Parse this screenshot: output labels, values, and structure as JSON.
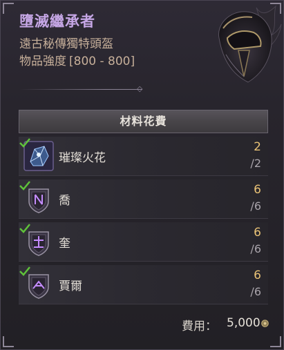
{
  "item": {
    "name": "墮滅繼承者",
    "type": "遠古秘傳獨特頭盔",
    "strength_label": "物品強度",
    "strength_value": "[800 - 800]"
  },
  "materials": {
    "header": "材料花費",
    "items": [
      {
        "name": "璀璨火花",
        "have": "2",
        "need": "/2",
        "icon": "sparkle-crystal-icon"
      },
      {
        "name": "喬",
        "have": "6",
        "need": "/6",
        "icon": "rune-shield-icon"
      },
      {
        "name": "奎",
        "have": "6",
        "need": "/6",
        "icon": "rune-shield-icon"
      },
      {
        "name": "賈爾",
        "have": "6",
        "need": "/6",
        "icon": "rune-shield-icon"
      }
    ]
  },
  "cost": {
    "label": "費用：",
    "value": "5,000",
    "icon": "gold-coin-icon"
  },
  "colors": {
    "item_name": "#c6a7e6",
    "item_text": "#c7b09a",
    "quantity": "#e9c276",
    "check": "#5fc23a"
  }
}
